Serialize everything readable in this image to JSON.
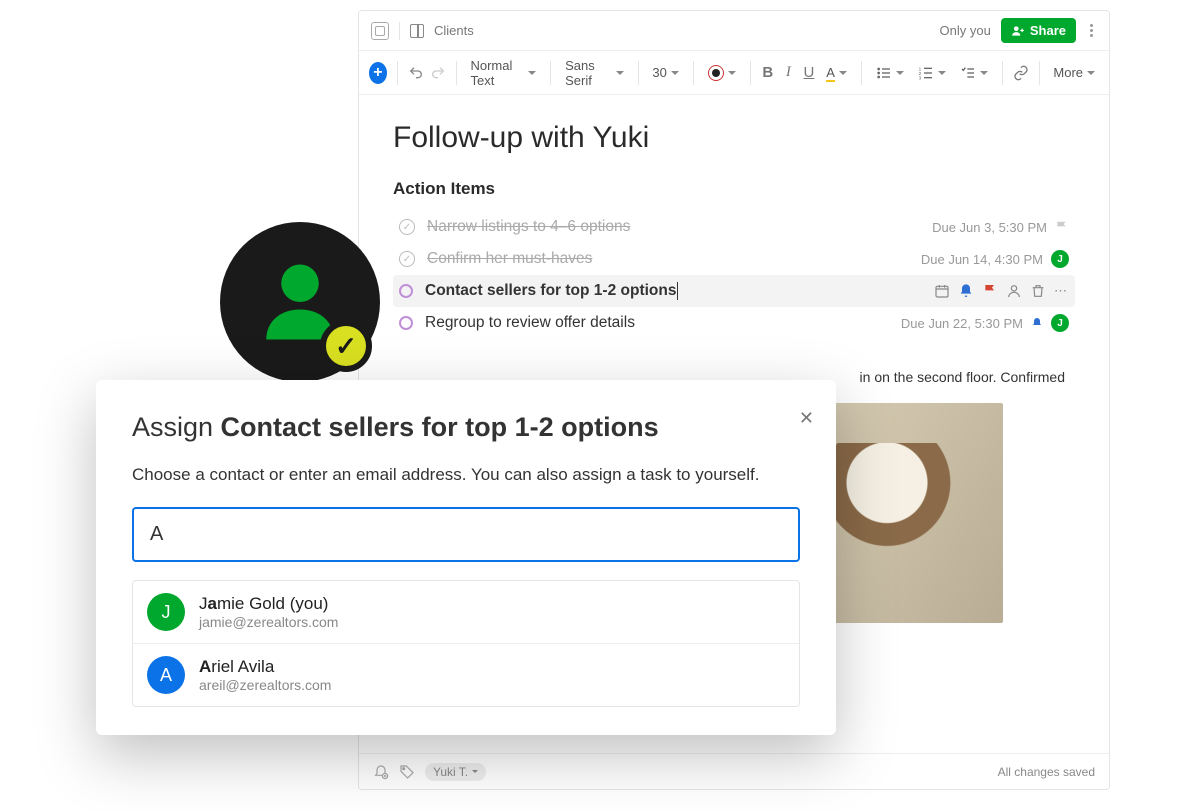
{
  "topbar": {
    "breadcrumb": "Clients",
    "visibility": "Only you",
    "share_label": "Share"
  },
  "toolbar": {
    "style_label": "Normal Text",
    "font_label": "Sans Serif",
    "size_label": "30",
    "more_label": "More"
  },
  "doc": {
    "title": "Follow-up with Yuki",
    "section": "Action Items",
    "tasks": [
      {
        "text": "Narrow listings to 4–6 options",
        "due": "Due Jun 3, 5:30 PM",
        "done": true,
        "assigned": false
      },
      {
        "text": "Confirm her must-haves",
        "due": "Due Jun 14, 4:30 PM",
        "done": true,
        "assigned": true
      },
      {
        "text": "Contact sellers for top 1-2 options",
        "due": "",
        "done": false,
        "selected": true
      },
      {
        "text": "Regroup to review offer details",
        "due": "Due Jun 22, 5:30 PM",
        "done": false,
        "assigned": true,
        "reminder": true
      }
    ],
    "body_fragment": "in on the second floor. Confirmed"
  },
  "footer": {
    "tag": "Yuki T.",
    "status": "All changes saved"
  },
  "assign": {
    "title_prefix": "Assign ",
    "title_bold": "Contact sellers for top 1-2 options",
    "subtitle": "Choose a contact or enter an email address. You can also assign a task to yourself.",
    "input_value": "A",
    "contacts": [
      {
        "initial": "J",
        "color": "#00a82d",
        "name_pre": "J",
        "name_bold": "a",
        "name_post": "mie Gold (you)",
        "email": "jamie@zerealtors.com"
      },
      {
        "initial": "A",
        "color": "#0b72e7",
        "name_pre": "",
        "name_bold": "A",
        "name_post": "riel Avila",
        "email": "areil@zerealtors.com"
      }
    ]
  }
}
